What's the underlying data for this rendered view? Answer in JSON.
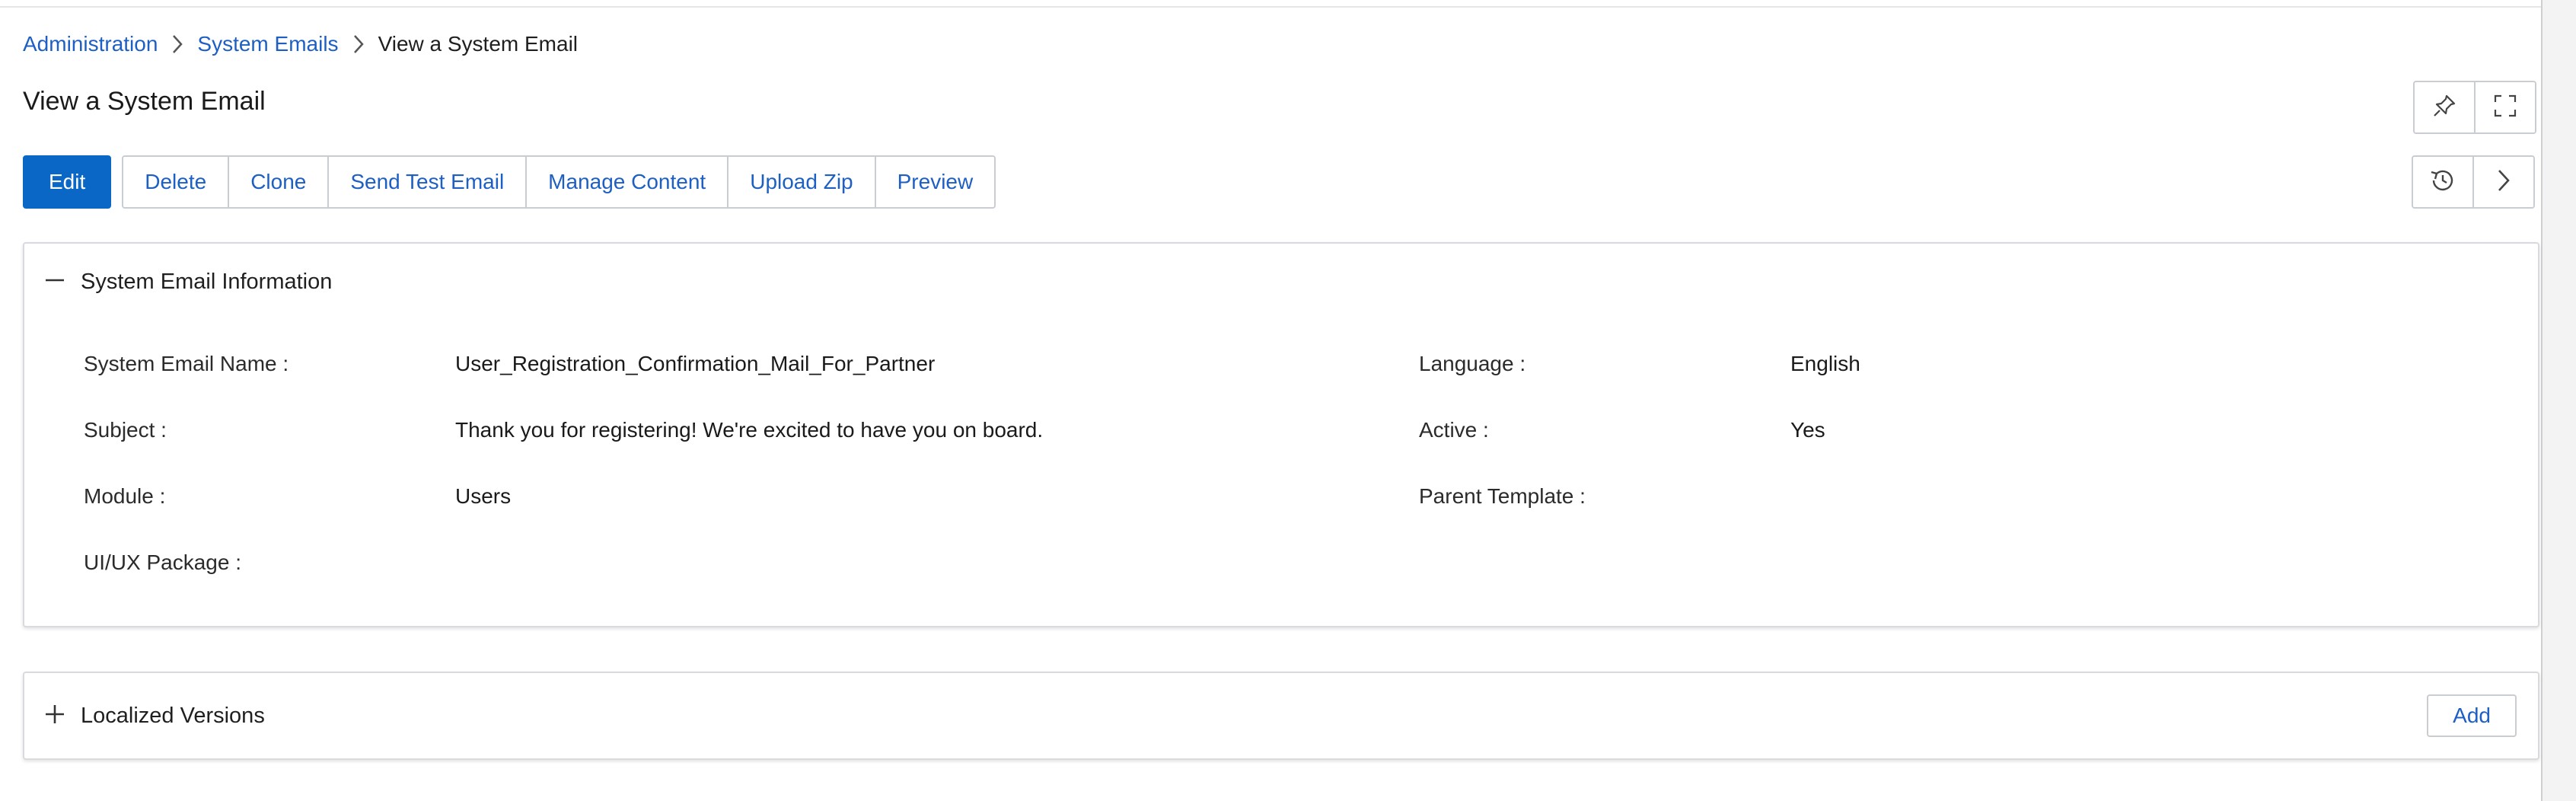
{
  "breadcrumb": {
    "items": [
      "Administration",
      "System Emails"
    ],
    "current": "View a System Email"
  },
  "page": {
    "title": "View a System Email"
  },
  "toolbar": {
    "edit_label": "Edit",
    "delete_label": "Delete",
    "clone_label": "Clone",
    "send_test_label": "Send Test Email",
    "manage_content_label": "Manage Content",
    "upload_zip_label": "Upload Zip",
    "preview_label": "Preview"
  },
  "header_icons": [
    "pin-icon",
    "fullscreen-icon",
    "history-icon",
    "chevron-right-icon"
  ],
  "info_panel": {
    "title": "System Email Information",
    "expanded": true,
    "fields": {
      "name": {
        "label": "System Email Name :",
        "value": "User_Registration_Confirmation_Mail_For_Partner"
      },
      "subject": {
        "label": "Subject :",
        "value": "Thank you for registering! We're excited to have you on board."
      },
      "module": {
        "label": "Module :",
        "value": "Users"
      },
      "uiux_package": {
        "label": "UI/UX Package :",
        "value": ""
      },
      "language": {
        "label": "Language :",
        "value": "English"
      },
      "active": {
        "label": "Active :",
        "value": "Yes"
      },
      "parent_template": {
        "label": "Parent Template :",
        "value": ""
      }
    }
  },
  "localized_panel": {
    "title": "Localized Versions",
    "expanded": false,
    "add_label": "Add"
  },
  "colors": {
    "primary": "#0b67c6",
    "link": "#1d5fc2",
    "border": "#c9ccd1"
  }
}
